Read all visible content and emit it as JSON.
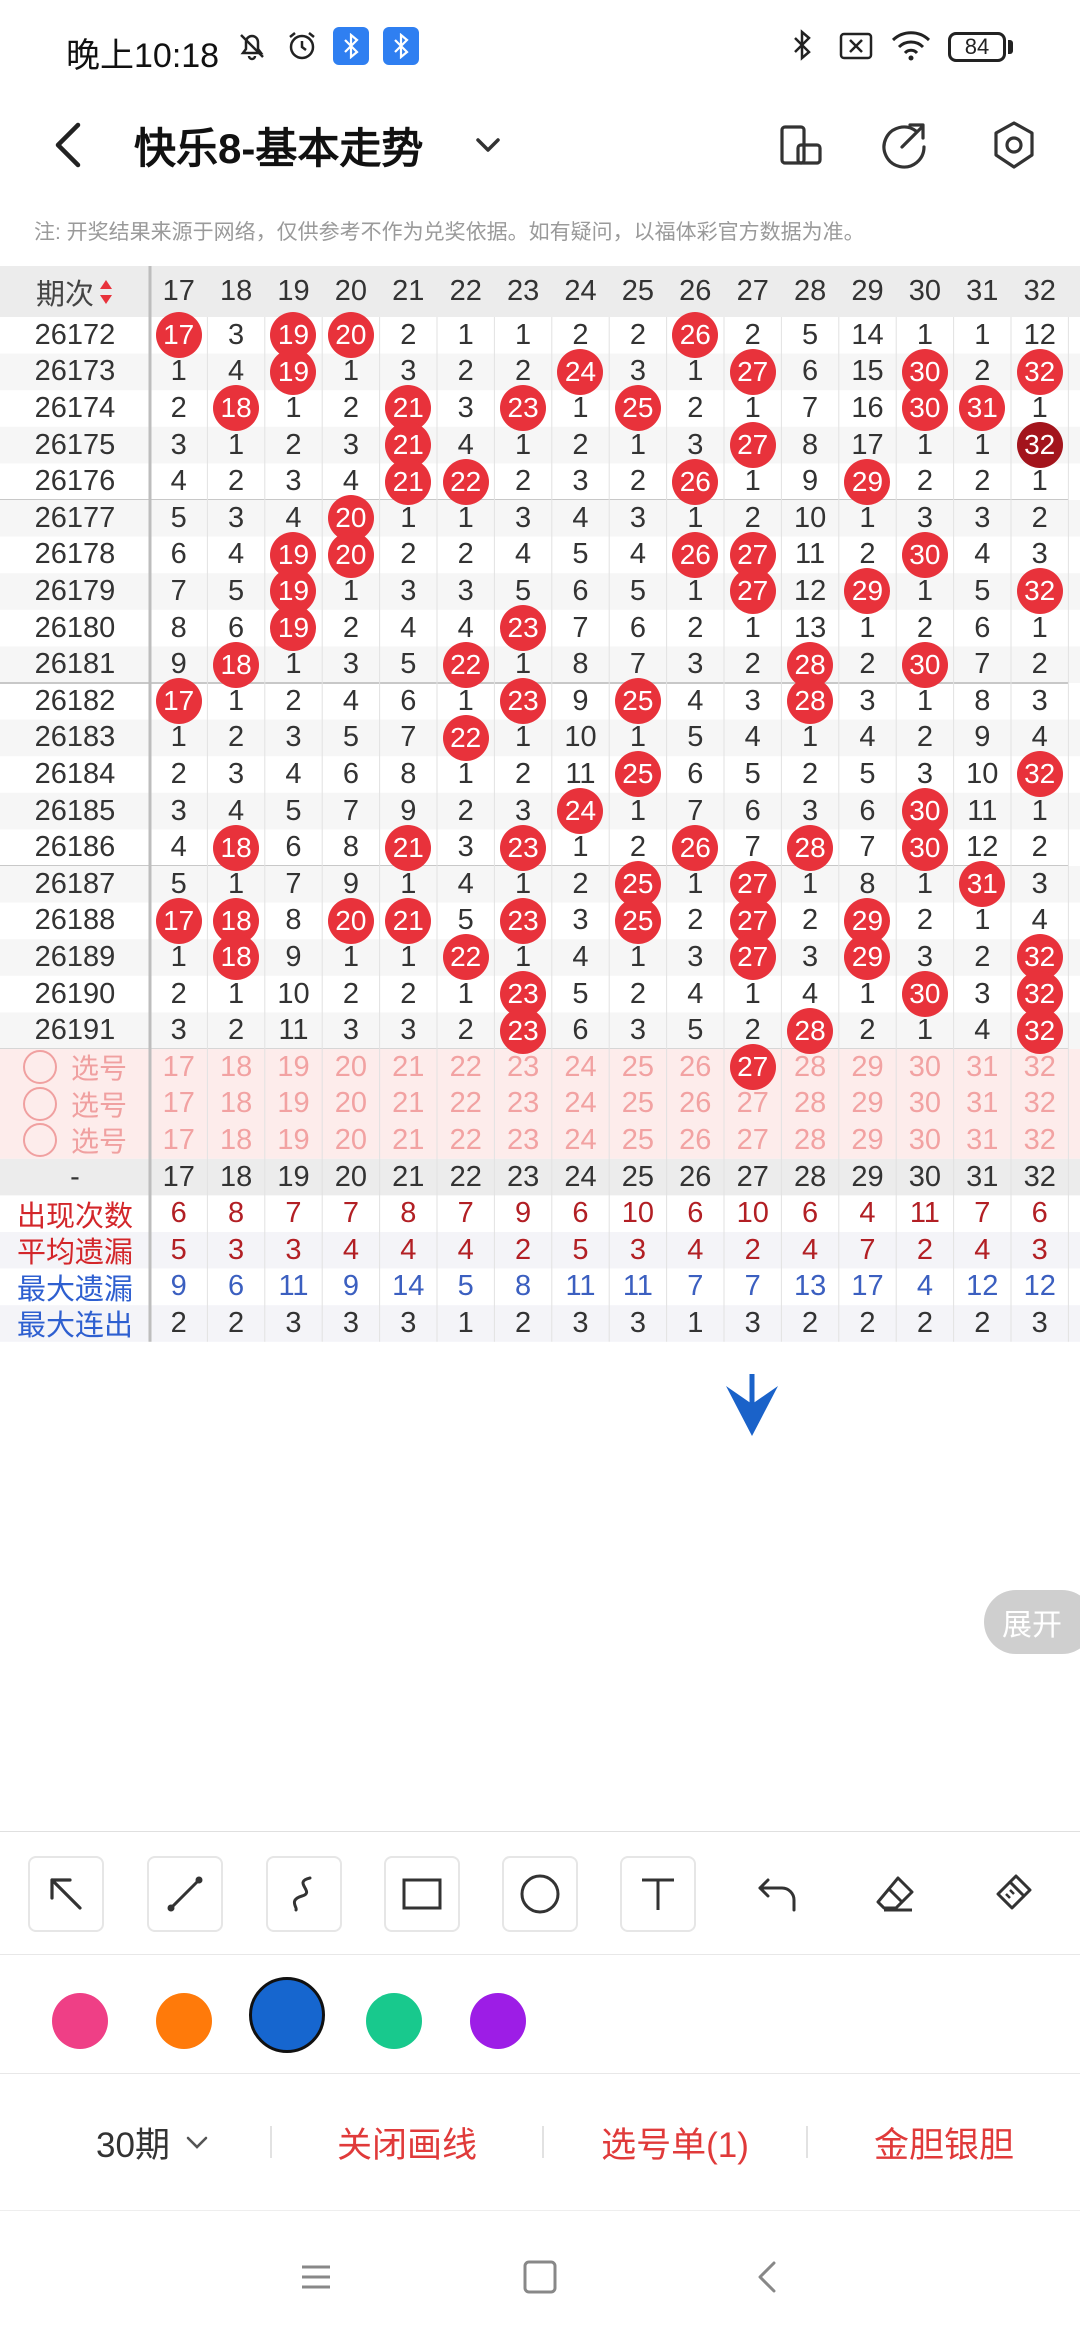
{
  "status_bar": {
    "time": "晚上10:18",
    "battery": "84",
    "icons": [
      "mute-bell-icon",
      "alarm-icon",
      "bluetooth-app-icon",
      "bluetooth-app-icon",
      "bluetooth-icon",
      "sim-off-icon",
      "wifi-icon",
      "battery-icon"
    ]
  },
  "header": {
    "title": "快乐8-基本走势",
    "icons": [
      "back-icon",
      "chevron-down-icon",
      "phone-rotate-icon",
      "share-icon",
      "settings-icon"
    ]
  },
  "note": "注: 开奖结果来源于网络，仅供参考不作为兑奖依据。如有疑问，以福体彩官方数据为准。",
  "table": {
    "corner_label": "期次",
    "columns": [
      "17",
      "18",
      "19",
      "20",
      "21",
      "22",
      "23",
      "24",
      "25",
      "26",
      "27",
      "28",
      "29",
      "30",
      "31",
      "32"
    ],
    "rows": [
      {
        "period": "26172",
        "values": [
          "17",
          "3",
          "19",
          "20",
          "2",
          "1",
          "1",
          "2",
          "2",
          "26",
          "2",
          "5",
          "14",
          "1",
          "1",
          "12"
        ],
        "hits": [
          0,
          2,
          3,
          9
        ]
      },
      {
        "period": "26173",
        "values": [
          "1",
          "4",
          "19",
          "1",
          "3",
          "2",
          "2",
          "24",
          "3",
          "1",
          "27",
          "6",
          "15",
          "30",
          "2",
          "32"
        ],
        "hits": [
          2,
          7,
          10,
          13,
          15
        ]
      },
      {
        "period": "26174",
        "values": [
          "2",
          "18",
          "1",
          "2",
          "21",
          "3",
          "23",
          "1",
          "25",
          "2",
          "1",
          "7",
          "16",
          "30",
          "31",
          "1"
        ],
        "hits": [
          1,
          4,
          6,
          8,
          13,
          14
        ]
      },
      {
        "period": "26175",
        "values": [
          "3",
          "1",
          "2",
          "3",
          "21",
          "4",
          "1",
          "2",
          "1",
          "3",
          "27",
          "8",
          "17",
          "1",
          "1",
          "32"
        ],
        "hits": [
          4,
          10,
          15
        ],
        "dark": [
          15
        ]
      },
      {
        "period": "26176",
        "values": [
          "4",
          "2",
          "3",
          "4",
          "21",
          "22",
          "2",
          "3",
          "2",
          "26",
          "1",
          "9",
          "29",
          "2",
          "2",
          "1"
        ],
        "hits": [
          4,
          5,
          9,
          12
        ]
      },
      {
        "period": "26177",
        "values": [
          "5",
          "3",
          "4",
          "20",
          "1",
          "1",
          "3",
          "4",
          "3",
          "1",
          "2",
          "10",
          "1",
          "3",
          "3",
          "2"
        ],
        "hits": [
          3
        ]
      },
      {
        "period": "26178",
        "values": [
          "6",
          "4",
          "19",
          "20",
          "2",
          "2",
          "4",
          "5",
          "4",
          "26",
          "27",
          "11",
          "2",
          "30",
          "4",
          "3"
        ],
        "hits": [
          2,
          3,
          9,
          10,
          13
        ]
      },
      {
        "period": "26179",
        "values": [
          "7",
          "5",
          "19",
          "1",
          "3",
          "3",
          "5",
          "6",
          "5",
          "1",
          "27",
          "12",
          "29",
          "1",
          "5",
          "32"
        ],
        "hits": [
          2,
          10,
          12,
          15
        ]
      },
      {
        "period": "26180",
        "values": [
          "8",
          "6",
          "19",
          "2",
          "4",
          "4",
          "23",
          "7",
          "6",
          "2",
          "1",
          "13",
          "1",
          "2",
          "6",
          "1"
        ],
        "hits": [
          2,
          6
        ]
      },
      {
        "period": "26181",
        "values": [
          "9",
          "18",
          "1",
          "3",
          "5",
          "22",
          "1",
          "8",
          "7",
          "3",
          "2",
          "28",
          "2",
          "30",
          "7",
          "2"
        ],
        "hits": [
          1,
          5,
          11,
          13
        ]
      },
      {
        "period": "26182",
        "values": [
          "17",
          "1",
          "2",
          "4",
          "6",
          "1",
          "23",
          "9",
          "25",
          "4",
          "3",
          "28",
          "3",
          "1",
          "8",
          "3"
        ],
        "hits": [
          0,
          6,
          8,
          11
        ]
      },
      {
        "period": "26183",
        "values": [
          "1",
          "2",
          "3",
          "5",
          "7",
          "22",
          "1",
          "10",
          "1",
          "5",
          "4",
          "1",
          "4",
          "2",
          "9",
          "4"
        ],
        "hits": [
          5
        ]
      },
      {
        "period": "26184",
        "values": [
          "2",
          "3",
          "4",
          "6",
          "8",
          "1",
          "2",
          "11",
          "25",
          "6",
          "5",
          "2",
          "5",
          "3",
          "10",
          "32"
        ],
        "hits": [
          8,
          15
        ]
      },
      {
        "period": "26185",
        "values": [
          "3",
          "4",
          "5",
          "7",
          "9",
          "2",
          "3",
          "24",
          "1",
          "7",
          "6",
          "3",
          "6",
          "30",
          "11",
          "1"
        ],
        "hits": [
          7,
          13
        ]
      },
      {
        "period": "26186",
        "values": [
          "4",
          "18",
          "6",
          "8",
          "21",
          "3",
          "23",
          "1",
          "2",
          "26",
          "7",
          "28",
          "7",
          "30",
          "12",
          "2"
        ],
        "hits": [
          1,
          4,
          6,
          9,
          11,
          13
        ]
      },
      {
        "period": "26187",
        "values": [
          "5",
          "1",
          "7",
          "9",
          "1",
          "4",
          "1",
          "2",
          "25",
          "1",
          "27",
          "1",
          "8",
          "1",
          "31",
          "3"
        ],
        "hits": [
          8,
          10,
          14
        ]
      },
      {
        "period": "26188",
        "values": [
          "17",
          "18",
          "8",
          "20",
          "21",
          "5",
          "23",
          "3",
          "25",
          "2",
          "27",
          "2",
          "29",
          "2",
          "1",
          "4"
        ],
        "hits": [
          0,
          1,
          3,
          4,
          6,
          8,
          10,
          12
        ]
      },
      {
        "period": "26189",
        "values": [
          "1",
          "18",
          "9",
          "1",
          "1",
          "22",
          "1",
          "4",
          "1",
          "3",
          "27",
          "3",
          "29",
          "3",
          "2",
          "32"
        ],
        "hits": [
          1,
          5,
          10,
          12,
          15
        ]
      },
      {
        "period": "26190",
        "values": [
          "2",
          "1",
          "10",
          "2",
          "2",
          "1",
          "23",
          "5",
          "2",
          "4",
          "1",
          "4",
          "1",
          "30",
          "3",
          "32"
        ],
        "hits": [
          6,
          13,
          15
        ]
      },
      {
        "period": "26191",
        "values": [
          "3",
          "2",
          "11",
          "3",
          "3",
          "2",
          "23",
          "6",
          "3",
          "5",
          "2",
          "28",
          "2",
          "1",
          "4",
          "32"
        ],
        "hits": [
          6,
          11,
          15
        ]
      }
    ],
    "select_rows": [
      {
        "label": "选号",
        "selected": [
          10
        ]
      },
      {
        "label": "选号",
        "selected": []
      },
      {
        "label": "选号",
        "selected": []
      }
    ],
    "footer_header_label": "-",
    "stats": [
      {
        "label": "出现次数",
        "values": [
          "6",
          "8",
          "7",
          "7",
          "8",
          "7",
          "9",
          "6",
          "10",
          "6",
          "10",
          "6",
          "4",
          "11",
          "7",
          "6"
        ]
      },
      {
        "label": "平均遗漏",
        "values": [
          "5",
          "3",
          "3",
          "4",
          "4",
          "4",
          "2",
          "5",
          "3",
          "4",
          "2",
          "4",
          "7",
          "2",
          "4",
          "3"
        ]
      },
      {
        "label": "最大遗漏",
        "values": [
          "9",
          "6",
          "11",
          "9",
          "14",
          "5",
          "8",
          "11",
          "11",
          "7",
          "7",
          "13",
          "17",
          "4",
          "12",
          "12"
        ]
      },
      {
        "label": "最大连出",
        "values": [
          "2",
          "2",
          "3",
          "3",
          "3",
          "1",
          "2",
          "3",
          "3",
          "1",
          "3",
          "2",
          "2",
          "2",
          "2",
          "3"
        ]
      }
    ]
  },
  "expand_label": "展开",
  "drawing_tools": [
    "arrow-tool-icon",
    "line-tool-icon",
    "curve-tool-icon",
    "rectangle-tool-icon",
    "circle-tool-icon",
    "text-tool-icon",
    "undo-icon",
    "eraser-icon",
    "clear-brush-icon"
  ],
  "palette": [
    "#ef3f86",
    "#ff7a0a",
    "#1666cf",
    "#18c98d",
    "#9d1de6"
  ],
  "selected_color_index": 2,
  "bottom_bar": {
    "period_label": "30期",
    "close_line": "关闭画线",
    "pick_list": "选号单(1)",
    "gold_silver": "金胆银胆"
  },
  "nav_icons": [
    "menu-icon",
    "home-icon",
    "back-nav-icon"
  ]
}
